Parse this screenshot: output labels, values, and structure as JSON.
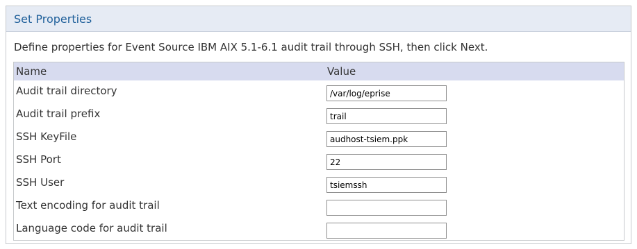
{
  "header": {
    "title": "Set Properties"
  },
  "description": "Define properties for Event Source IBM AIX 5.1-6.1 audit trail through SSH, then click Next.",
  "table": {
    "columns": [
      "Name",
      "Value"
    ],
    "rows": [
      {
        "label": "Audit trail directory",
        "value": "/var/log/eprise"
      },
      {
        "label": "Audit trail prefix",
        "value": "trail"
      },
      {
        "label": "SSH KeyFile",
        "value": "audhost-tsiem.ppk"
      },
      {
        "label": "SSH Port",
        "value": "22"
      },
      {
        "label": "SSH User",
        "value": "tsiemssh"
      },
      {
        "label": "Text encoding for audit trail",
        "value": ""
      },
      {
        "label": "Language code for audit trail",
        "value": ""
      }
    ]
  }
}
